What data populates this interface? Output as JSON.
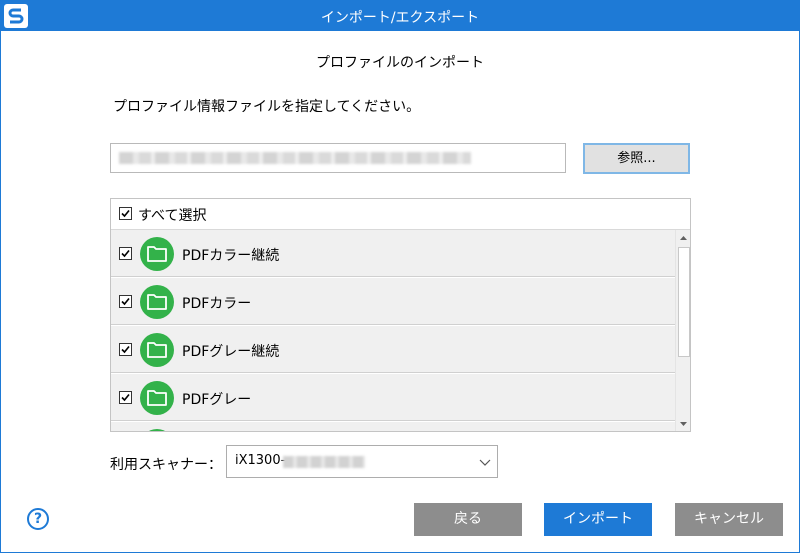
{
  "window": {
    "title": "インポート/エクスポート"
  },
  "dialog": {
    "heading": "プロファイルのインポート",
    "instruction": "プロファイル情報ファイルを指定してください。",
    "browse_label": "参照...",
    "select_all_label": "すべて選択",
    "select_all_checked": true,
    "profiles": [
      {
        "label": "PDFカラー継続",
        "checked": true,
        "icon": "folder-icon"
      },
      {
        "label": "PDFカラー",
        "checked": true,
        "icon": "folder-icon"
      },
      {
        "label": "PDFグレー継続",
        "checked": true,
        "icon": "folder-icon"
      },
      {
        "label": "PDFグレー",
        "checked": true,
        "icon": "folder-icon"
      }
    ],
    "scanner_label": "利用スキャナー：",
    "scanner_value": "iX1300-"
  },
  "buttons": {
    "back": "戻る",
    "import": "インポート",
    "cancel": "キャンセル"
  },
  "colors": {
    "accent": "#1e7ad6",
    "folder_green": "#33b24a",
    "secondary_button": "#8d8d8d"
  }
}
